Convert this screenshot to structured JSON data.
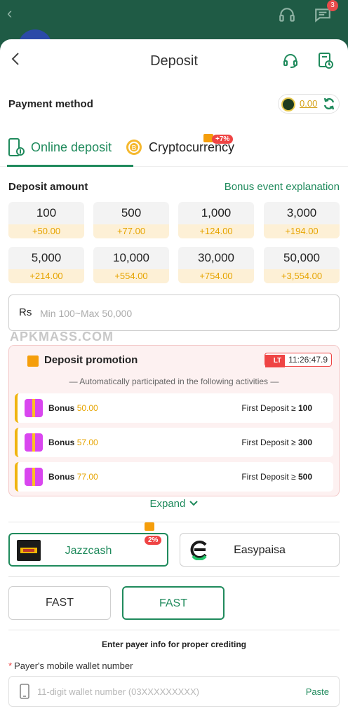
{
  "background_header": {
    "chat_badge": "3"
  },
  "header": {
    "title": "Deposit"
  },
  "payment_method": {
    "label": "Payment method",
    "balance": "0.00"
  },
  "tabs": [
    {
      "label": "Online deposit",
      "active": true
    },
    {
      "label": "Cryptocurrency",
      "active": false,
      "promo": "+7%"
    }
  ],
  "deposit_amount": {
    "label": "Deposit amount",
    "link": "Bonus event explanation",
    "options": [
      {
        "amount": "100",
        "bonus": "+50.00"
      },
      {
        "amount": "500",
        "bonus": "+77.00"
      },
      {
        "amount": "1,000",
        "bonus": "+124.00"
      },
      {
        "amount": "3,000",
        "bonus": "+194.00"
      },
      {
        "amount": "5,000",
        "bonus": "+214.00"
      },
      {
        "amount": "10,000",
        "bonus": "+554.00"
      },
      {
        "amount": "30,000",
        "bonus": "+754.00"
      },
      {
        "amount": "50,000",
        "bonus": "+3,554.00"
      }
    ],
    "currency": "Rs",
    "placeholder": "Min 100~Max 50,000"
  },
  "watermark": "APKMASS.COM",
  "promotion": {
    "title": "Deposit promotion",
    "timer_tag": "LT",
    "timer": "11:26:47.9",
    "subtitle": "Automatically participated in the following activities",
    "items": [
      {
        "bonus_label": "Bonus",
        "bonus_value": "50.00",
        "condition": "First Deposit ≥",
        "min": "100"
      },
      {
        "bonus_label": "Bonus",
        "bonus_value": "57.00",
        "condition": "First Deposit ≥",
        "min": "300"
      },
      {
        "bonus_label": "Bonus",
        "bonus_value": "77.00",
        "condition": "First Deposit ≥",
        "min": "500"
      }
    ],
    "expand": "Expand"
  },
  "channels": [
    {
      "label": "Jazzcash",
      "active": true,
      "promo": "2%"
    },
    {
      "label": "Easypaisa",
      "active": false
    }
  ],
  "speeds": [
    {
      "label": "FAST",
      "active": false
    },
    {
      "label": "FAST",
      "active": true
    }
  ],
  "payer": {
    "title": "Enter payer info for proper crediting",
    "wallet_label": "Payer's mobile wallet number",
    "required_mark": "*",
    "wallet_placeholder": "11-digit wallet number (03XXXXXXXXX)",
    "paste": "Paste"
  },
  "colors": {
    "primary": "#1f8a5c",
    "bonus": "#e6a400",
    "header_bg": "#1f5b45",
    "promo_red": "#ef4444"
  }
}
